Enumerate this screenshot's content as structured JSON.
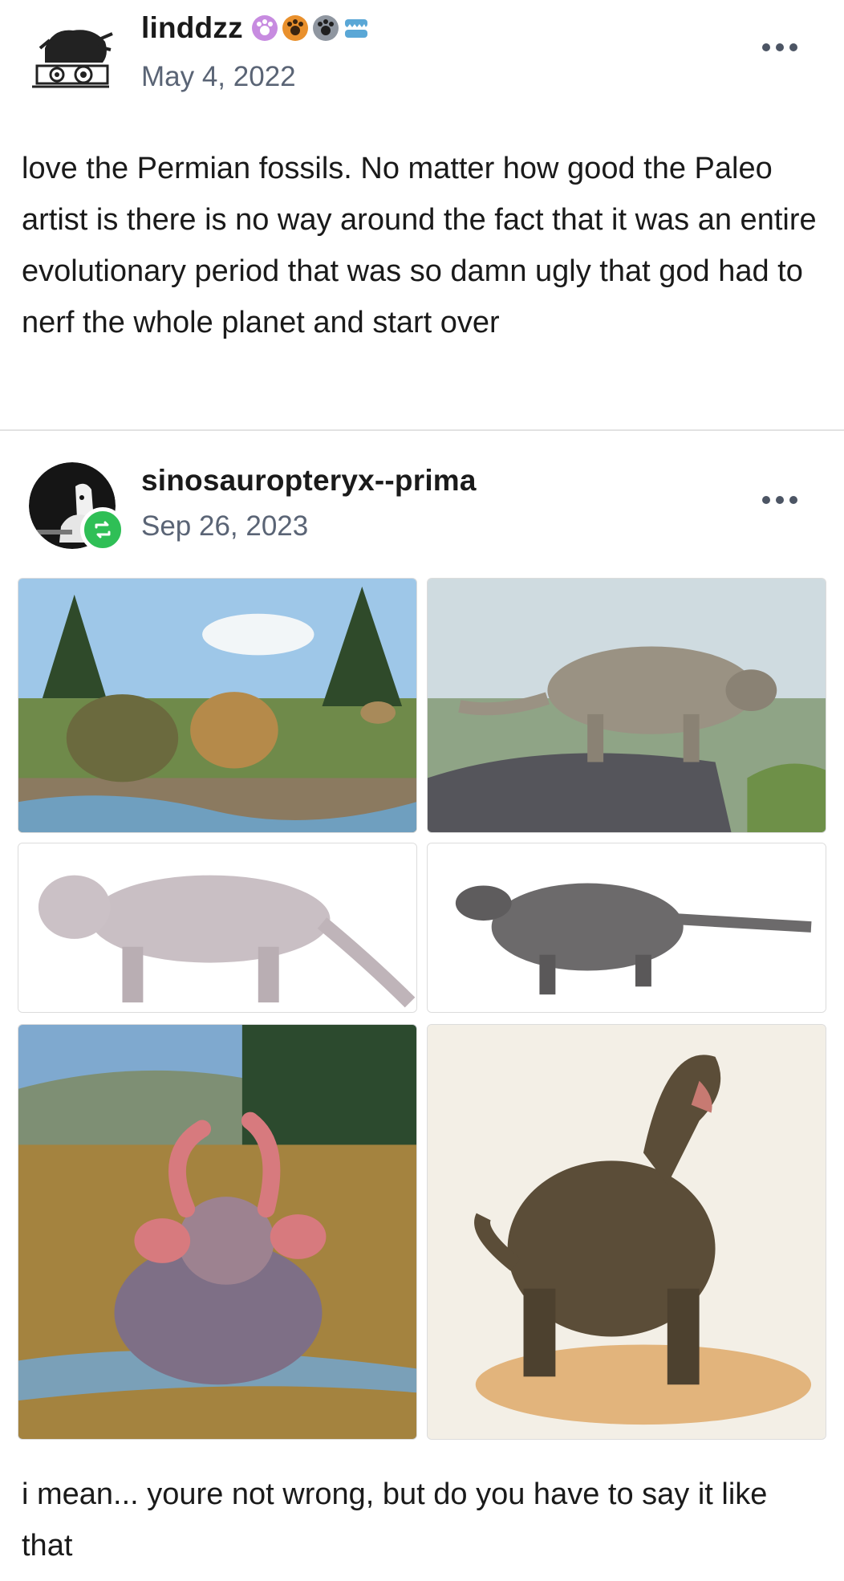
{
  "post1": {
    "username": "linddzz",
    "date": "May 4, 2022",
    "text": "love the Permian fossils. No matter how good the Paleo artist is there is no way around the fact that it was an entire evolutionary period that was so damn ugly that god had to nerf the whole planet and start over",
    "badges": [
      "paw-pink-badge",
      "paw-orange-badge",
      "paw-gray-badge",
      "chomper-teeth-badge"
    ]
  },
  "post2": {
    "username": "sinosauropteryx--prima",
    "date": "Sep 26, 2023",
    "text": "i mean... youre not wrong, but do you have to say it like that",
    "reblog_icon": "reblog-icon",
    "photos": [
      "estemmenosuchus-and-gorgonopsid-scene",
      "moschops-on-rock",
      "lystrosaurus-illustration",
      "scutosaurus-illustration",
      "estemmenosuchus-with-horns",
      "moschops-standing"
    ]
  },
  "colors": {
    "text": "#1a1a1a",
    "secondary": "#5a6475",
    "reblog_green": "#2fbf56",
    "divider": "#e2e2e2"
  }
}
